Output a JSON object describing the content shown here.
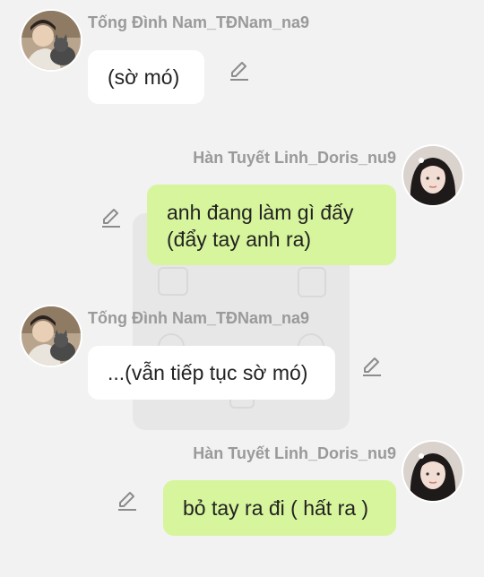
{
  "chat": {
    "messages": [
      {
        "side": "left",
        "sender": "Tống Đình Nam_TĐNam_na9",
        "text": "(sờ mó)",
        "avatar": "male-avatar-with-cat"
      },
      {
        "side": "right",
        "sender": "Hàn Tuyết Linh_Doris_nu9",
        "text": "anh đang làm gì đấy\n(đẩy tay anh ra)",
        "avatar": "female-avatar"
      },
      {
        "side": "left",
        "sender": "Tống Đình Nam_TĐNam_na9",
        "text": "...(vẫn tiếp tục sờ mó)",
        "avatar": "male-avatar-with-cat"
      },
      {
        "side": "right",
        "sender": "Hàn Tuyết Linh_Doris_nu9",
        "text": "bỏ tay ra đi ( hất ra )",
        "avatar": "female-avatar"
      }
    ],
    "icons": {
      "edit": "pencil-edit-icon"
    },
    "colors": {
      "background": "#f2f2f2",
      "bubble_left": "#ffffff",
      "bubble_right": "#d7f59c",
      "sender_name": "#9a9a9a",
      "text": "#222222"
    }
  }
}
